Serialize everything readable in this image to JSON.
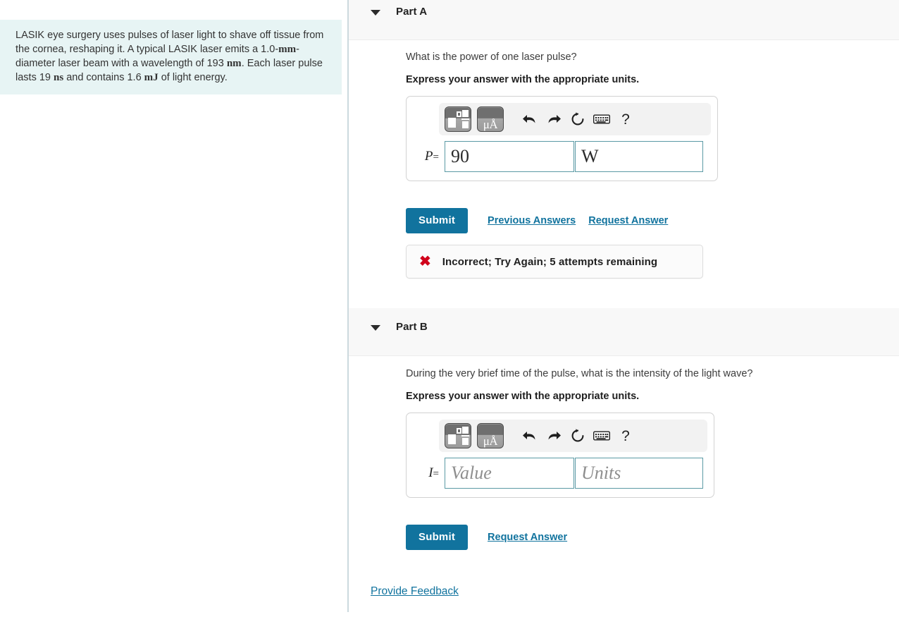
{
  "problem": {
    "segments": [
      {
        "text": "LASIK eye surgery uses pulses of laser light to shave off tissue from the cornea, reshaping it. A typical LASIK laser emits a 1.0-",
        "style": "normal"
      },
      {
        "text": "mm",
        "style": "unit"
      },
      {
        "text": "-diameter laser beam with a wavelength of 193 ",
        "style": "normal"
      },
      {
        "text": "nm",
        "style": "unit"
      },
      {
        "text": ". Each laser pulse lasts 19 ",
        "style": "normal"
      },
      {
        "text": "ns",
        "style": "unit"
      },
      {
        "text": " and contains 1.6 ",
        "style": "normal"
      },
      {
        "text": "mJ",
        "style": "unit"
      },
      {
        "text": " of light energy.",
        "style": "normal"
      }
    ],
    "full_text": "LASIK eye surgery uses pulses of laser light to shave off tissue from the cornea, reshaping it. A typical LASIK laser emits a 1.0-mm-diameter laser beam with a wavelength of 193 nm. Each laser pulse lasts 19 ns and contains 1.6 mJ of light energy.",
    "background_color": "#e7f4f4"
  },
  "toolbar": {
    "buttons": [
      {
        "name": "template-button",
        "label": ""
      },
      {
        "name": "units-button",
        "label": "μÅ"
      },
      {
        "name": "undo-button",
        "label": ""
      },
      {
        "name": "redo-button",
        "label": ""
      },
      {
        "name": "reset-button",
        "label": ""
      },
      {
        "name": "keyboard-button",
        "label": ""
      },
      {
        "name": "help-button",
        "label": "?"
      }
    ],
    "units_glyph_mu": "μ",
    "units_glyph_angstrom": "Å",
    "help_label": "?"
  },
  "parts": [
    {
      "id": "part-a",
      "title": "Part A",
      "question": "What is the power of one laser pulse?",
      "instruction": "Express your answer with the appropriate units.",
      "variable": "P",
      "equals": "=",
      "value": "90",
      "units": "W",
      "value_placeholder": "Value",
      "units_placeholder": "Units",
      "submit_label": "Submit",
      "links": [
        "Previous Answers",
        "Request Answer"
      ],
      "feedback": {
        "icon": "x-mark-icon",
        "message": "Incorrect; Try Again; 5 attempts remaining",
        "color": "#d0021b"
      }
    },
    {
      "id": "part-b",
      "title": "Part B",
      "question": "During the very brief time of the pulse, what is the intensity of the light wave?",
      "instruction": "Express your answer with the appropriate units.",
      "variable": "I",
      "equals": "=",
      "value": "",
      "units": "",
      "value_placeholder": "Value",
      "units_placeholder": "Units",
      "submit_label": "Submit",
      "links": [
        "Request Answer"
      ]
    }
  ],
  "footer": {
    "provide_feedback": "Provide Feedback"
  },
  "colors": {
    "accent": "#11739e",
    "problem_bg": "#e7f4f4",
    "header_bg": "#f8f8f8",
    "field_border": "#5b9aa5",
    "error": "#d0021b"
  }
}
